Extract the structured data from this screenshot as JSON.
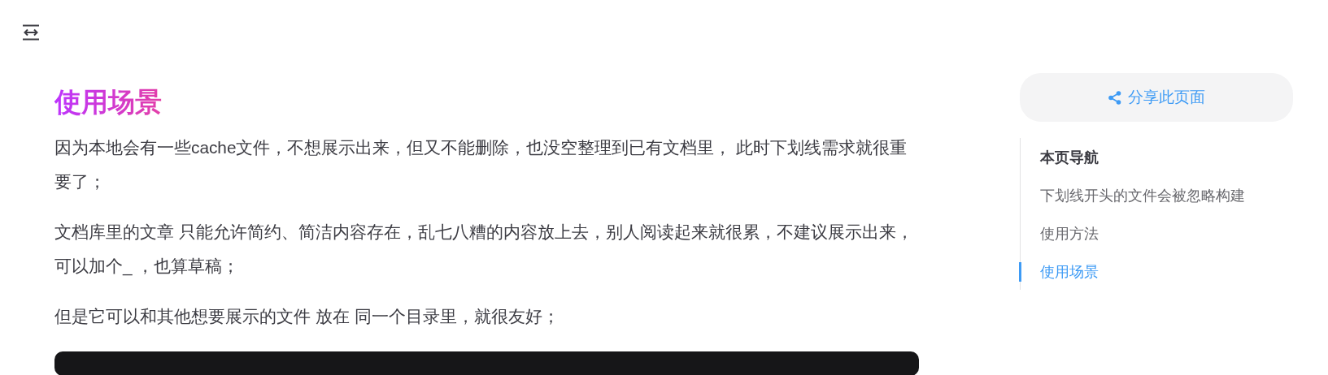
{
  "article": {
    "heading": "使用场景",
    "paragraphs": [
      "因为本地会有一些cache文件，不想展示出来，但又不能删除，也没空整理到已有文档里， 此时下划线需求就很重要了；",
      "文档库里的文章 只能允许简约、简洁内容存在，乱七八糟的内容放上去，别人阅读起来就很累，不建议展示出来，可以加个_ ，也算草稿；",
      "但是它可以和其他想要展示的文件 放在 同一个目录里，就很友好；"
    ]
  },
  "aside": {
    "share_button": "分享此页面",
    "toc": {
      "title": "本页导航",
      "items": [
        {
          "label": "下划线开头的文件会被忽略构建",
          "selected": false
        },
        {
          "label": "使用方法",
          "selected": false
        },
        {
          "label": "使用场景",
          "selected": true
        }
      ]
    }
  }
}
